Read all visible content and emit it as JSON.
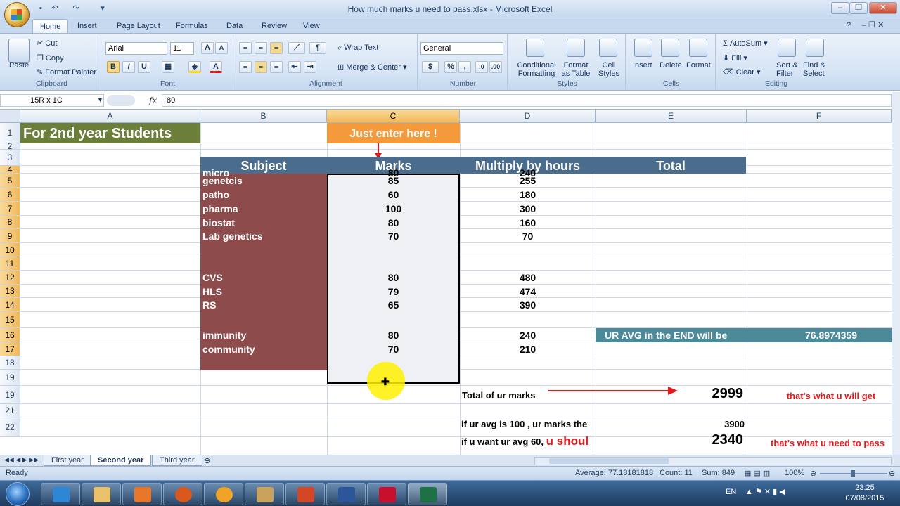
{
  "window": {
    "title": "How much marks u need to pass.xlsx - Microsoft Excel",
    "qat": [
      "save-icon",
      "undo-icon",
      "redo-icon",
      "customize-icon"
    ]
  },
  "ribbon_tabs": [
    "Home",
    "Insert",
    "Page Layout",
    "Formulas",
    "Data",
    "Review",
    "View"
  ],
  "ribbon": {
    "clipboard": {
      "paste": "Paste",
      "cut": "Cut",
      "copy": "Copy",
      "format_painter": "Format Painter",
      "label": "Clipboard"
    },
    "font": {
      "name": "Arial",
      "size": "11",
      "label": "Font",
      "bold": "B",
      "italic": "I",
      "underline": "U"
    },
    "alignment": {
      "wrap": "Wrap Text",
      "merge": "Merge & Center",
      "label": "Alignment"
    },
    "number": {
      "format": "General",
      "percent": "%",
      "comma": ",",
      "label": "Number"
    },
    "styles": {
      "conditional": "Conditional",
      "conditional2": "Formatting",
      "format_table": "Format",
      "format_table2": "as Table",
      "cell_styles": "Cell",
      "cell_styles2": "Styles",
      "label": "Styles"
    },
    "cells": {
      "insert": "Insert",
      "delete": "Delete",
      "format": "Format",
      "label": "Cells"
    },
    "editing": {
      "autosum": "AutoSum",
      "fill": "Fill",
      "clear": "Clear",
      "sort": "Sort &",
      "sort2": "Filter",
      "find": "Find &",
      "find2": "Select",
      "label": "Editing"
    }
  },
  "formula_bar": {
    "name_box": "15R x 1C",
    "fx": "fx",
    "value": "80"
  },
  "columns": [
    "A",
    "B",
    "C",
    "D",
    "E",
    "F"
  ],
  "rows": [
    "1",
    "2",
    "3",
    "4",
    "5",
    "6",
    "7",
    "8",
    "9",
    "10",
    "11",
    "12",
    "13",
    "14",
    "15",
    "16",
    "17",
    "18",
    "19",
    "19",
    "21",
    "22"
  ],
  "cells": {
    "a1": "For 2nd year Students",
    "c1": "Just enter here !",
    "b3": "Subject",
    "c3": "Marks",
    "d3": "Multiply by hours",
    "e3": "Total",
    "subjects": [
      "micro",
      "genetcis",
      "patho",
      "pharma",
      "biostat",
      "Lab genetics",
      "",
      "",
      "CVS",
      "HLS",
      "RS",
      "",
      "immunity",
      "community"
    ],
    "marks": [
      "80",
      "85",
      "60",
      "100",
      "80",
      "70",
      "",
      "",
      "80",
      "79",
      "65",
      "",
      "80",
      "70"
    ],
    "hours": [
      "240",
      "255",
      "180",
      "300",
      "160",
      "70",
      "",
      "",
      "480",
      "474",
      "390",
      "",
      "240",
      "210"
    ],
    "e15": "UR AVG in the END will be",
    "f15": "76.8974359",
    "d19": "Total of ur marks",
    "e19": "2999",
    "f19": "that's what u will get",
    "d21": "if ur avg is 100 , ur marks the",
    "e21": "3900",
    "d22a": "if u want ur avg 60, ",
    "d22b": "u shoul",
    "e22": "2340",
    "f22": "that's what u need to pass"
  },
  "sheet_tabs": [
    "First year",
    "Second year",
    "Third year"
  ],
  "status": {
    "ready": "Ready",
    "average": "Average: 77.18181818",
    "count": "Count: 11",
    "sum": "Sum: 849",
    "zoom": "100%"
  },
  "taskbar": {
    "lang": "EN",
    "time": "23:25",
    "date": "07/08/2015"
  },
  "colors": {
    "subject_fill": "#8e4b4b",
    "header_fill": "#4a6d8e",
    "title_fill": "#6b7f3a",
    "orange": "#f59a3a",
    "teal": "#4d8a99",
    "red": "#e31a1c"
  }
}
